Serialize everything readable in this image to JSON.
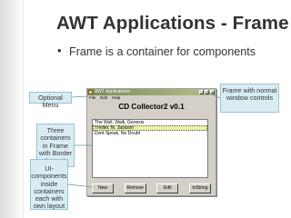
{
  "slide": {
    "title": "AWT Applications - Frame",
    "bullet": "Frame is a container for components"
  },
  "callouts": {
    "menu": "Optional Menu",
    "containers": "Three containers in Frame with Border Layout",
    "ui": "UI-components inside containers each with own layout",
    "frame": "Frame with normal window controls"
  },
  "window": {
    "title": "AWT Applications",
    "controls": [
      "_",
      "□",
      "×"
    ],
    "menus": [
      "File",
      "Edit",
      "Help"
    ],
    "heading": "CD Collector2 v0.1",
    "tracks": [
      "The Wall, Walk, Genesis",
      "Thriller, M. Jackson",
      "Dont Speak, No Doubt"
    ],
    "selected_track": 1,
    "buttons": [
      "New",
      "Remove",
      "Edit",
      "toString"
    ]
  },
  "colors": {
    "callout_fill": "#d9ecf3",
    "callout_border": "#9cc2d2",
    "selected_row": "#ebf0a6",
    "titlebar": "#7a8a5a"
  }
}
